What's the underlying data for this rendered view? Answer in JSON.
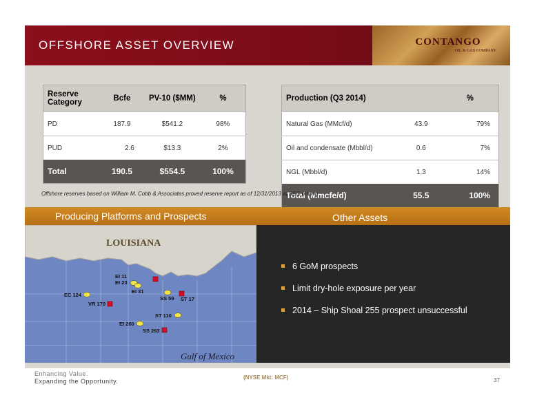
{
  "header": {
    "title": "OFFSHORE ASSET OVERVIEW",
    "logo_text": "CONTANGO",
    "logo_subtext": "OIL & GAS COMPANY"
  },
  "reserves_table": {
    "headers": [
      "Reserve Category",
      "Bcfe",
      "PV-10 ($MM)",
      "%"
    ],
    "rows": [
      [
        "PD",
        "187.9",
        "$541.2",
        "98%"
      ],
      [
        "PUD",
        "2.6",
        "$13.3",
        "2%"
      ]
    ],
    "total": [
      "Total",
      "190.5",
      "$554.5",
      "100%"
    ]
  },
  "production_table": {
    "headers": [
      "Production (Q3 2014)",
      "",
      "%"
    ],
    "rows": [
      [
        "Natural Gas (MMcf/d)",
        "43.9",
        "79%"
      ],
      [
        "Oil and condensate (Mbbl/d)",
        "0.6",
        "7%"
      ],
      [
        "NGL (Mbbl/d)",
        "1.3",
        "14%"
      ]
    ],
    "total": [
      "Total (Mmcfe/d)",
      "55.5",
      "100%"
    ]
  },
  "footnote": "Offshore reserves based on William M. Cobb & Associates proved reserve report as of 12/31/2013 at SEC pricing",
  "sections": {
    "left": "Producing Platforms and Prospects",
    "right": "Other Assets"
  },
  "map": {
    "state_label": "LOUISIANA",
    "gulf_label": "Gulf of Mexico",
    "markers": [
      "EI 11",
      "EI 23",
      "EI 31",
      "EC 124",
      "VR 170",
      "SS 59",
      "ST 17",
      "ST 110",
      "EI 260",
      "SS 263"
    ]
  },
  "other_assets": [
    "6 GoM prospects",
    "Limit dry-hole exposure per year",
    "2014 – Ship Shoal 255 prospect unsuccessful"
  ],
  "footer": {
    "tagline1": "Enhancing Value.",
    "tagline2": "Expanding the Opportunity.",
    "ticker": "(NYSE Mkt: MCF)",
    "page": "37"
  },
  "colors": {
    "header_red": "#8b0f1c",
    "band_orange": "#c77d1c",
    "marker_yellow": "#f2e24a",
    "marker_red": "#d0102a",
    "bullet_orange": "#e0a040"
  }
}
